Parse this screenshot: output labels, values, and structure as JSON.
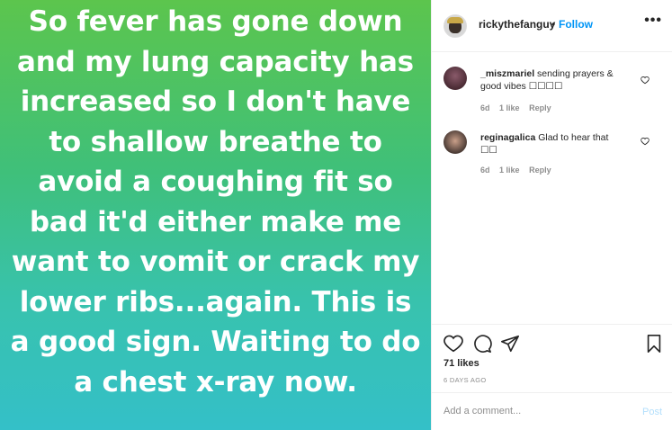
{
  "post": {
    "text": "So fever has gone down and my lung capacity has increased so I don't have to shallow breathe to avoid a coughing fit so bad it'd either make me want to vomit or crack my lower ribs...again. This is a good sign. Waiting to do a chest x-ray now.",
    "gradient": [
      "#5cc54d",
      "#34c0c8"
    ]
  },
  "header": {
    "username": "rickythefanguy",
    "separator": "•",
    "follow": "Follow",
    "more": "•••"
  },
  "comments": [
    {
      "user": "_miszmariel",
      "text": "sending prayers & good vibes ☐☐☐☐",
      "age": "6d",
      "likes": "1 like",
      "reply": "Reply"
    },
    {
      "user": "reginagalica",
      "text": "Glad to hear that ☐☐",
      "age": "6d",
      "likes": "1 like",
      "reply": "Reply"
    }
  ],
  "stats": {
    "likes": "71 likes",
    "time": "6 DAYS AGO"
  },
  "composer": {
    "placeholder": "Add a comment...",
    "post": "Post"
  },
  "colors": {
    "link": "#0095f6",
    "muted": "#8e8e8e",
    "post_disabled": "#b2dffc"
  }
}
